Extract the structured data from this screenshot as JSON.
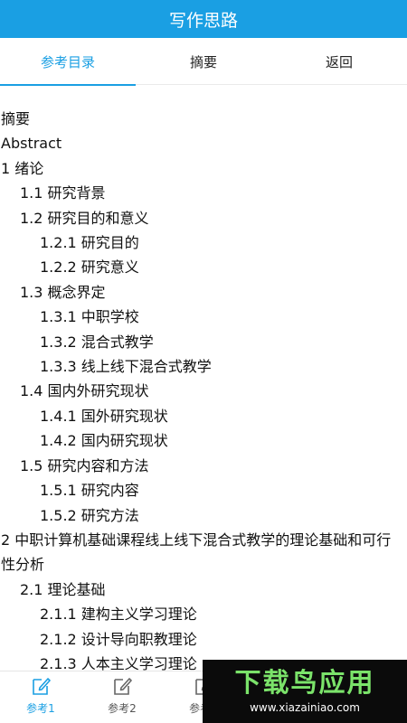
{
  "app": {
    "title": "写作思路"
  },
  "tabs": [
    {
      "label": "参考目录",
      "active": true
    },
    {
      "label": "摘要",
      "active": false
    },
    {
      "label": "返回",
      "active": false
    }
  ],
  "toc": [
    {
      "text": "摘要",
      "level": 0
    },
    {
      "text": "Abstract",
      "level": 0
    },
    {
      "text": "1 绪论",
      "level": 0
    },
    {
      "text": "1.1 研究背景",
      "level": 1
    },
    {
      "text": "1.2 研究目的和意义",
      "level": 1
    },
    {
      "text": "1.2.1 研究目的",
      "level": 2
    },
    {
      "text": "1.2.2 研究意义",
      "level": 2
    },
    {
      "text": "1.3 概念界定",
      "level": 1
    },
    {
      "text": "1.3.1 中职学校",
      "level": 2
    },
    {
      "text": "1.3.2 混合式教学",
      "level": 2
    },
    {
      "text": "1.3.3 线上线下混合式教学",
      "level": 2
    },
    {
      "text": "1.4 国内外研究现状",
      "level": 1
    },
    {
      "text": "1.4.1 国外研究现状",
      "level": 2
    },
    {
      "text": "1.4.2 国内研究现状",
      "level": 2
    },
    {
      "text": "1.5 研究内容和方法",
      "level": 1
    },
    {
      "text": "1.5.1 研究内容",
      "level": 2
    },
    {
      "text": "1.5.2 研究方法",
      "level": 2
    },
    {
      "text": "2 中职计算机基础课程线上线下混合式教学的理论基础和可行性分析",
      "level": 0
    },
    {
      "text": "2.1 理论基础",
      "level": 1
    },
    {
      "text": "2.1.1 建构主义学习理论",
      "level": 2
    },
    {
      "text": "2.1.2 设计导向职教理论",
      "level": 2
    },
    {
      "text": "2.1.3 人本主义学习理论",
      "level": 2
    }
  ],
  "bottom_nav": [
    {
      "label": "参考1",
      "active": true
    },
    {
      "label": "参考2",
      "active": false
    },
    {
      "label": "参考3",
      "active": false
    }
  ],
  "watermark": {
    "title": "下载鸟应用",
    "url": "www.xiazainiao.com"
  },
  "colors": {
    "accent": "#1a9fe3",
    "watermark_green": "#7be36a"
  }
}
